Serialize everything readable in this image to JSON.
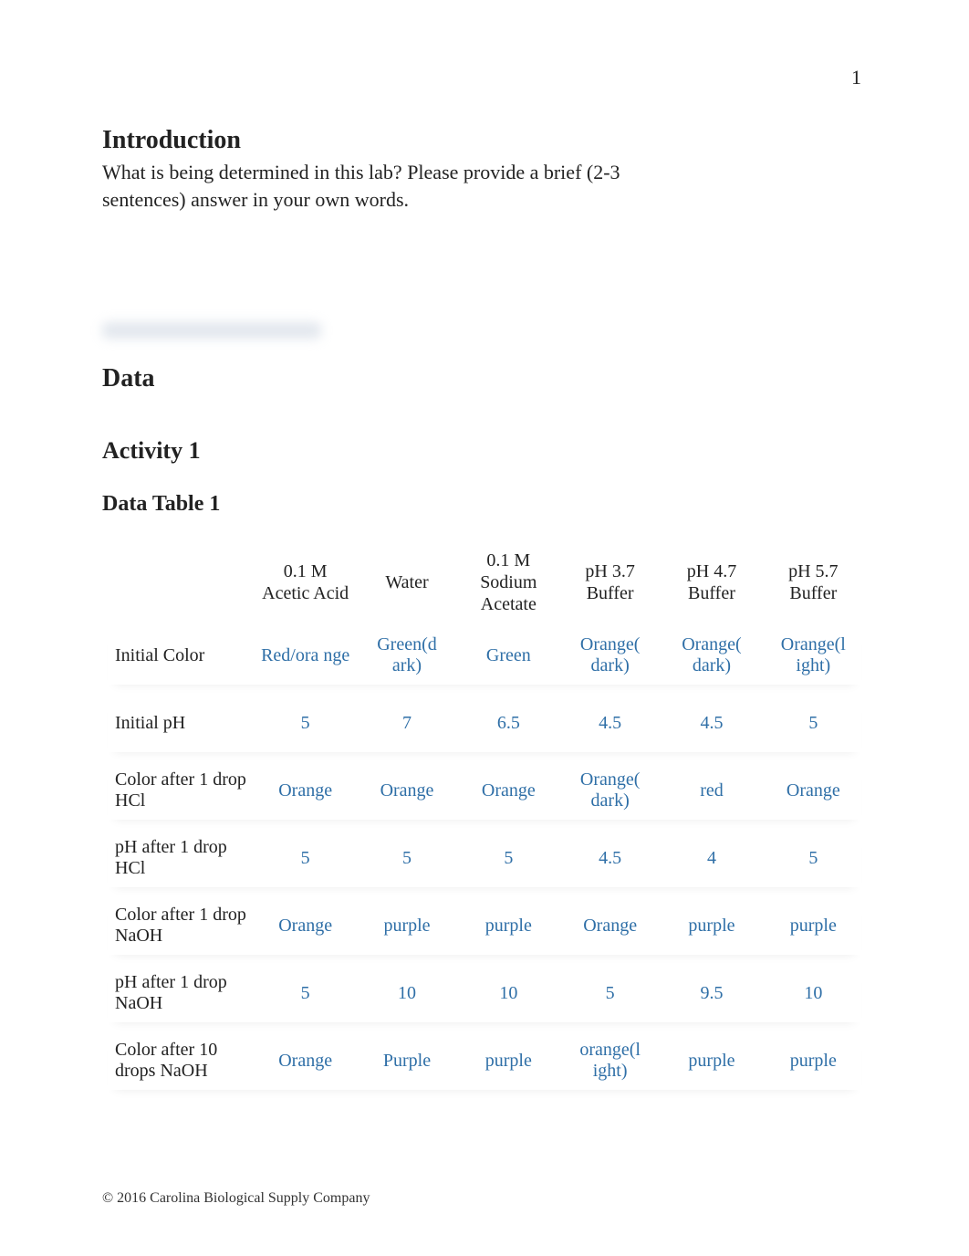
{
  "page_number": "1",
  "introduction": {
    "title": "Introduction",
    "prompt": "What is being determined in this lab? Please provide a brief (2-3 sentences) answer in your own words."
  },
  "headings": {
    "data": "Data",
    "activity": "Activity 1",
    "data_table": "Data Table 1"
  },
  "table": {
    "columns": [
      "",
      "0.1 M Acetic Acid",
      "Water",
      "0.1 M Sodium Acetate",
      "pH 3.7 Buffer",
      "pH 4.7 Buffer",
      "pH 5.7 Buffer"
    ],
    "rows": [
      {
        "label": "Initial Color",
        "values": [
          "Red/ora\nnge",
          "Green(d\nark)",
          "Green",
          "Orange(\ndark)",
          "Orange(\ndark)",
          "Orange(l\night)"
        ]
      },
      {
        "label": "Initial pH",
        "values": [
          "5",
          "7",
          "6.5",
          "4.5",
          "4.5",
          "5"
        ]
      },
      {
        "label": "Color after 1 drop HCl",
        "values": [
          "Orange",
          "Orange",
          "Orange",
          "Orange(\ndark)",
          "red",
          "Orange"
        ]
      },
      {
        "label": "pH after 1 drop HCl",
        "values": [
          "5",
          "5",
          "5",
          "4.5",
          "4",
          "5"
        ]
      },
      {
        "label": "Color after 1 drop NaOH",
        "values": [
          "Orange",
          "purple",
          "purple",
          "Orange",
          "purple",
          "purple"
        ]
      },
      {
        "label": "pH after 1 drop NaOH",
        "values": [
          "5",
          "10",
          "10",
          "5",
          "9.5",
          "10"
        ]
      },
      {
        "label": "Color after 10 drops NaOH",
        "values": [
          "Orange",
          "Purple",
          "purple",
          "orange(l\night)",
          "purple",
          "purple"
        ]
      }
    ]
  },
  "footer": "© 2016 Carolina Biological Supply Company",
  "chart_data": [
    {
      "type": "table",
      "title": "Data Table 1",
      "columns": [
        "0.1 M Acetic Acid",
        "Water",
        "0.1 M Sodium Acetate",
        "pH 3.7 Buffer",
        "pH 4.7 Buffer",
        "pH 5.7 Buffer"
      ],
      "rows": [
        {
          "metric": "Initial Color",
          "values": [
            "Red/orange",
            "Green(dark)",
            "Green",
            "Orange(dark)",
            "Orange(dark)",
            "Orange(light)"
          ]
        },
        {
          "metric": "Initial pH",
          "values": [
            5,
            7,
            6.5,
            4.5,
            4.5,
            5
          ]
        },
        {
          "metric": "Color after 1 drop HCl",
          "values": [
            "Orange",
            "Orange",
            "Orange",
            "Orange(dark)",
            "red",
            "Orange"
          ]
        },
        {
          "metric": "pH after 1 drop HCl",
          "values": [
            5,
            5,
            5,
            4.5,
            4,
            5
          ]
        },
        {
          "metric": "Color after 1 drop NaOH",
          "values": [
            "Orange",
            "purple",
            "purple",
            "Orange",
            "purple",
            "purple"
          ]
        },
        {
          "metric": "pH after 1 drop NaOH",
          "values": [
            5,
            10,
            10,
            5,
            9.5,
            10
          ]
        },
        {
          "metric": "Color after 10 drops NaOH",
          "values": [
            "Orange",
            "Purple",
            "purple",
            "orange(light)",
            "purple",
            "purple"
          ]
        }
      ]
    }
  ]
}
